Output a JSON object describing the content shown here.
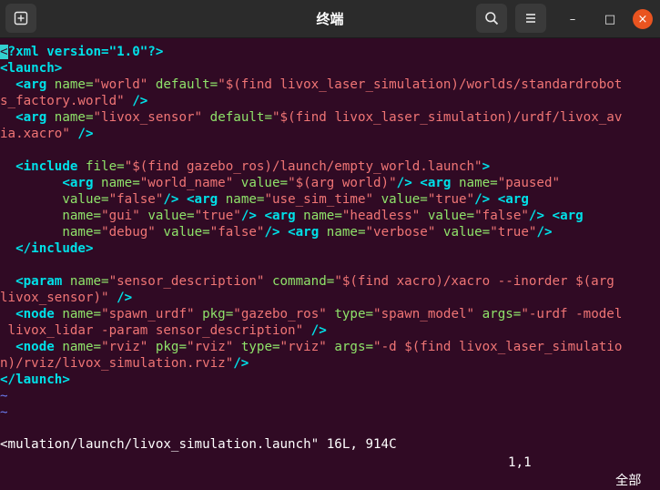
{
  "window": {
    "title": "终端",
    "buttons": {
      "new_tab_icon": "new-tab-icon",
      "search_icon": "search-icon",
      "menu_icon": "hamburger-menu-icon",
      "minimize": "–",
      "maximize": "□",
      "close": "×"
    },
    "accent_close": "#e95420"
  },
  "terminal": {
    "background": "#300a24",
    "cursor_char": "<",
    "lines": {
      "l1_rest": "?xml version=\"1.0\"?>",
      "l2": "<launch>",
      "l3_tag": "  <arg ",
      "l3_a1": "name=",
      "l3_s1": "\"world\"",
      "l3_a2": " default=",
      "l3_s2": "\"$(find livox_laser_simulation)/worlds/standardrobot",
      "l4_s": "s_factory.world\"",
      "l4_t": " />",
      "l5_tag": "  <arg ",
      "l5_a1": "name=",
      "l5_s1": "\"livox_sensor\"",
      "l5_a2": " default=",
      "l5_s2": "\"$(find livox_laser_simulation)/urdf/livox_av",
      "l6_s": "ia.xacro\"",
      "l6_t": " />",
      "l8_tag": "  <include ",
      "l8_a": "file=",
      "l8_s": "\"$(find gazebo_ros)/launch/empty_world.launch\"",
      "l8_e": ">",
      "l9_tag": "        <arg ",
      "l9_a1": "name=",
      "l9_s1": "\"world_name\"",
      "l9_a2": " value=",
      "l9_s2": "\"$(arg world)\"",
      "l9_t2": "/> <arg ",
      "l9_a3": "name=",
      "l9_s3": "\"paused\"",
      "l10_ind": "        ",
      "l10_a1": "value=",
      "l10_s1": "\"false\"",
      "l10_t1": "/> <arg ",
      "l10_a2": "name=",
      "l10_s2": "\"use_sim_time\"",
      "l10_a3": " value=",
      "l10_s3": "\"true\"",
      "l10_t2": "/> <arg",
      "l11_ind": "        ",
      "l11_a1": "name=",
      "l11_s1": "\"gui\"",
      "l11_a2": " value=",
      "l11_s2": "\"true\"",
      "l11_t1": "/> <arg ",
      "l11_a3": "name=",
      "l11_s3": "\"headless\"",
      "l11_a4": " value=",
      "l11_s4": "\"false\"",
      "l11_t2": "/> <arg",
      "l12_ind": "        ",
      "l12_a1": "name=",
      "l12_s1": "\"debug\"",
      "l12_a2": " value=",
      "l12_s2": "\"false\"",
      "l12_t1": "/> <arg ",
      "l12_a3": "name=",
      "l12_s3": "\"verbose\"",
      "l12_a4": " value=",
      "l12_s4": "\"true\"",
      "l12_t2": "/>",
      "l13": "  </include>",
      "l15_tag": "  <param ",
      "l15_a1": "name=",
      "l15_s1": "\"sensor_description\"",
      "l15_a2": " command=",
      "l15_s2": "\"$(find xacro)/xacro --inorder $(arg",
      "l16_s": "livox_sensor)\"",
      "l16_t": " />",
      "l17_tag": "  <node ",
      "l17_a1": "name=",
      "l17_s1": "\"spawn_urdf\"",
      "l17_a2": " pkg=",
      "l17_s2": "\"gazebo_ros\"",
      "l17_a3": " type=",
      "l17_s3": "\"spawn_model\"",
      "l17_a4": " args=",
      "l17_s4": "\"-urdf -model",
      "l18_s": " livox_lidar -param sensor_description\"",
      "l18_t": " />",
      "l19_tag": "  <node ",
      "l19_a1": "name=",
      "l19_s1": "\"rviz\"",
      "l19_a2": " pkg=",
      "l19_s2": "\"rviz\"",
      "l19_a3": " type=",
      "l19_s3": "\"rviz\"",
      "l19_a4": " args=",
      "l19_s4": "\"-d $(find livox_laser_simulatio",
      "l20_s": "n)/rviz/livox_simulation.rviz\"",
      "l20_t": "/>",
      "l21": "</launch>",
      "tilde": "~"
    }
  },
  "status": {
    "file": "<mulation/launch/livox_simulation.launch\" 16L, 914C",
    "position": "1,1",
    "scroll": "全部"
  }
}
